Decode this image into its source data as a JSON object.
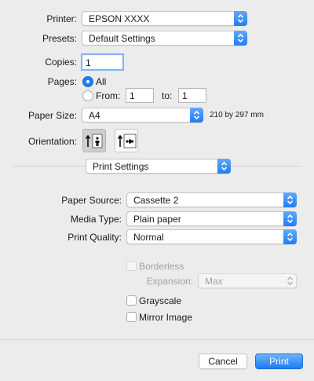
{
  "printer": {
    "label": "Printer:",
    "value": "EPSON XXXX"
  },
  "presets": {
    "label": "Presets:",
    "value": "Default Settings"
  },
  "copies": {
    "label": "Copies:",
    "value": "1"
  },
  "pages": {
    "label": "Pages:",
    "all_label": "All",
    "from_label": "From:",
    "from_value": "1",
    "to_label": "to:",
    "to_value": "1",
    "selected": "All"
  },
  "paper_size": {
    "label": "Paper Size:",
    "value": "A4",
    "dimensions": "210 by 297 mm"
  },
  "orientation": {
    "label": "Orientation:",
    "selected": "portrait"
  },
  "section_menu": {
    "value": "Print Settings"
  },
  "paper_source": {
    "label": "Paper Source:",
    "value": "Cassette 2"
  },
  "media_type": {
    "label": "Media Type:",
    "value": "Plain paper"
  },
  "print_quality": {
    "label": "Print Quality:",
    "value": "Normal"
  },
  "borderless": {
    "label": "Borderless",
    "checked": false,
    "enabled": false
  },
  "expansion": {
    "label": "Expansion:",
    "value": "Max",
    "enabled": false
  },
  "grayscale": {
    "label": "Grayscale",
    "checked": false
  },
  "mirror_image": {
    "label": "Mirror Image",
    "checked": false
  },
  "buttons": {
    "cancel": "Cancel",
    "print": "Print"
  },
  "colors": {
    "accent": "#1f7ef4",
    "background": "#ececec"
  }
}
